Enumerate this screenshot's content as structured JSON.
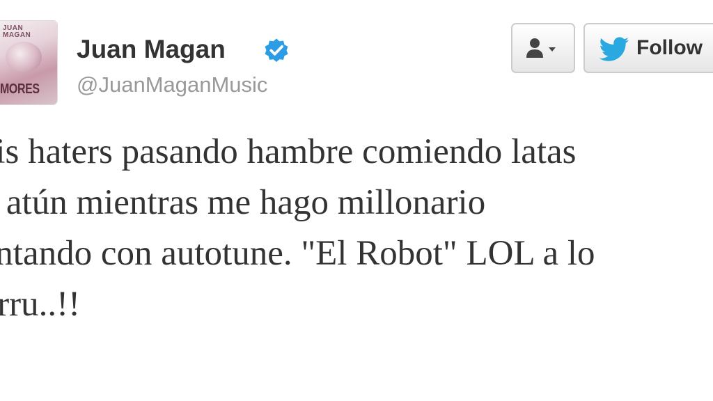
{
  "user": {
    "display_name": "Juan Magan",
    "handle": "@JuanMaganMusic",
    "verified": true,
    "avatar": {
      "top_text": "JUAN\nMAGAN",
      "bottom_text": "MORES"
    }
  },
  "actions": {
    "user_menu_icon": "person-dropdown-icon",
    "follow_label": "Follow"
  },
  "tweet": {
    "lines": [
      "Mis haters pasando hambre comiendo latas",
      "de atún mientras me hago millonario",
      "cantando con autotune. \"El Robot\" LOL a lo",
      "barru..!!"
    ]
  },
  "colors": {
    "verified_blue": "#2c9ce4",
    "twitter_blue": "#2aa9e0",
    "text": "#333333",
    "muted": "#999999"
  }
}
